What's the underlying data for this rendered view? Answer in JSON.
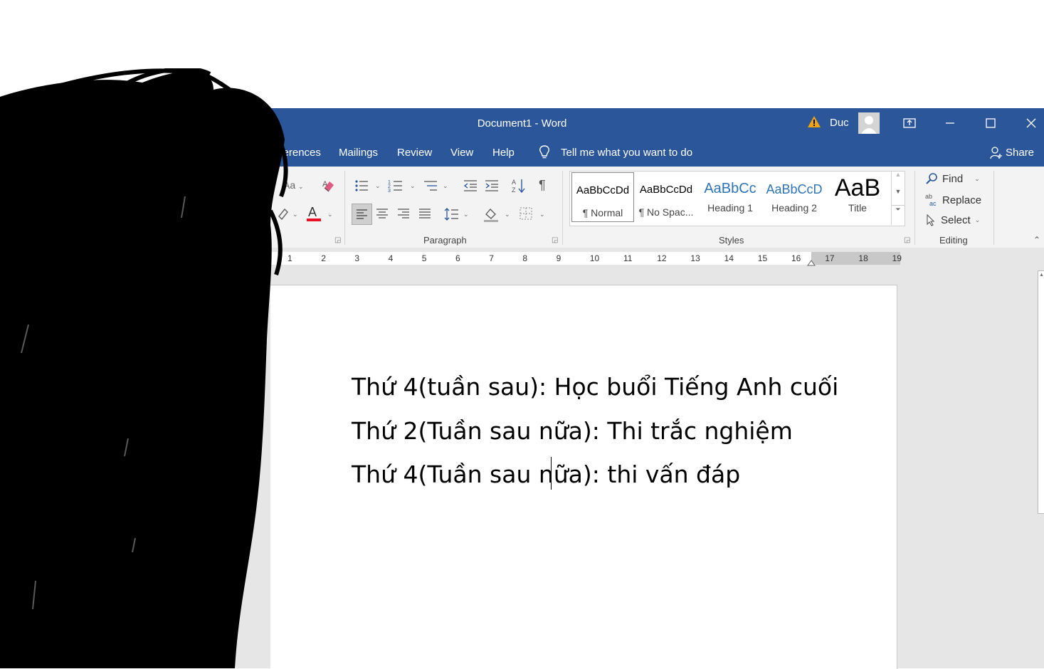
{
  "window": {
    "title": "Document1  -  Word",
    "user": "Duc",
    "colors": {
      "accent": "#2b579a",
      "ribbon_bg": "#f3f3f3",
      "warn": "#f0a30a",
      "font_color_bar": "#e81123",
      "heading": "#2e74b5"
    }
  },
  "menu": {
    "tabs": [
      "eferences",
      "Mailings",
      "Review",
      "View",
      "Help"
    ],
    "tell_me": "Tell me what you want to do",
    "share": "Share"
  },
  "ribbon": {
    "paragraph_label": "Paragraph",
    "styles_label": "Styles",
    "editing_label": "Editing",
    "change_case": "Aa",
    "styles": [
      {
        "sample": "AaBbCcDd",
        "name": "¶ Normal"
      },
      {
        "sample": "AaBbCcDd",
        "name": "¶ No Spac..."
      },
      {
        "sample": "AaBbCc",
        "name": "Heading 1"
      },
      {
        "sample": "AaBbCcD",
        "name": "Heading 2"
      },
      {
        "sample": "AaB",
        "name": "Title"
      }
    ],
    "editing": {
      "find": "Find",
      "replace": "Replace",
      "select": "Select"
    }
  },
  "ruler": {
    "ticks": [
      "1",
      "2",
      "3",
      "4",
      "5",
      "6",
      "7",
      "8",
      "9",
      "10",
      "11",
      "12",
      "13",
      "14",
      "15",
      "16",
      "17",
      "18",
      "19"
    ]
  },
  "document": {
    "lines": [
      "Thứ 4(tuần sau): Học buổi Tiếng Anh cuối",
      "Thứ 2(Tuần sau nữa): Thi trắc nghiệm",
      "Thứ 4(Tuần sau nữa): thi vấn đáp"
    ]
  }
}
